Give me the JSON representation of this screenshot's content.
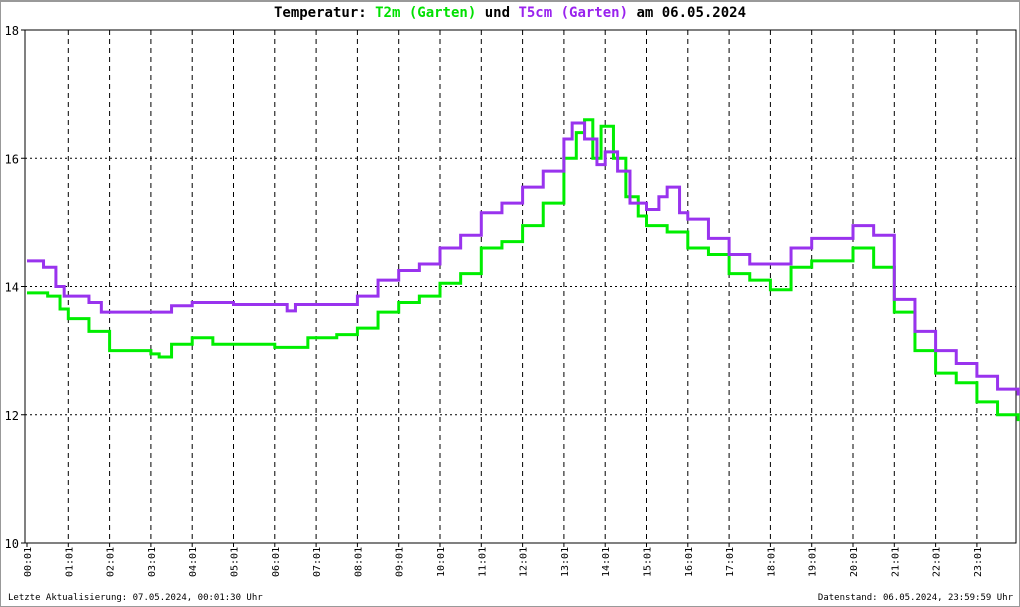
{
  "title": {
    "prefix": "Temperatur: ",
    "series1": "T2m (Garten)",
    "mid": " und ",
    "series2": "T5cm (Garten)",
    "suffix": " am 06.05.2024"
  },
  "footer": {
    "left": "Letzte Aktualisierung: 07.05.2024, 00:01:30 Uhr",
    "right": "Datenstand: 06.05.2024, 23:59:59 Uhr"
  },
  "chart_data": {
    "type": "line",
    "title": "Temperatur: T2m (Garten) und T5cm (Garten) am 06.05.2024",
    "xlabel": "",
    "ylabel": "",
    "ylim": [
      10,
      18
    ],
    "xlim_hours": [
      0,
      24
    ],
    "yticks": [
      "10",
      "12",
      "14",
      "16",
      "18"
    ],
    "xticks": [
      "00:01",
      "01:01",
      "02:01",
      "03:01",
      "04:01",
      "05:01",
      "06:01",
      "07:01",
      "08:01",
      "09:01",
      "10:01",
      "11:01",
      "12:01",
      "13:01",
      "14:01",
      "15:01",
      "16:01",
      "17:01",
      "18:01",
      "19:01",
      "20:01",
      "21:01",
      "22:01",
      "23:01"
    ],
    "grid": true,
    "series": [
      {
        "name": "T2m (Garten)",
        "color": "#00ee00",
        "x": [
          0,
          0.5,
          0.8,
          1.0,
          1.5,
          2.0,
          3.0,
          3.2,
          3.5,
          4.0,
          4.5,
          5.0,
          6.0,
          6.8,
          7.5,
          8.0,
          8.5,
          9.0,
          9.5,
          10.0,
          10.5,
          11.0,
          11.5,
          12.0,
          12.5,
          13.0,
          13.3,
          13.5,
          13.7,
          13.9,
          14.2,
          14.5,
          14.8,
          15.0,
          15.5,
          16.0,
          16.5,
          17.0,
          17.5,
          18.0,
          18.5,
          19.0,
          19.5,
          20.0,
          20.5,
          21.0,
          21.5,
          22.0,
          22.5,
          23.0,
          23.5,
          24.0
        ],
        "y": [
          13.9,
          13.85,
          13.65,
          13.5,
          13.3,
          13.0,
          12.95,
          12.9,
          13.1,
          13.2,
          13.1,
          13.1,
          13.05,
          13.2,
          13.25,
          13.35,
          13.6,
          13.75,
          13.85,
          14.05,
          14.2,
          14.6,
          14.7,
          14.95,
          15.3,
          16.0,
          16.4,
          16.6,
          16.0,
          16.5,
          16.0,
          15.4,
          15.1,
          14.95,
          14.85,
          14.6,
          14.5,
          14.2,
          14.1,
          13.95,
          14.3,
          14.4,
          14.4,
          14.6,
          14.3,
          13.6,
          13.0,
          12.65,
          12.5,
          12.2,
          12.0,
          11.9
        ]
      },
      {
        "name": "T5cm (Garten)",
        "color": "#9933ee",
        "x": [
          0,
          0.4,
          0.7,
          0.9,
          1.5,
          1.8,
          2.5,
          3.5,
          4.0,
          5.0,
          6.0,
          6.3,
          6.5,
          7.5,
          8.0,
          8.5,
          9.0,
          9.5,
          10.0,
          10.5,
          11.0,
          11.5,
          12.0,
          12.5,
          13.0,
          13.2,
          13.5,
          13.8,
          14.0,
          14.3,
          14.6,
          15.0,
          15.3,
          15.5,
          15.8,
          16.0,
          16.5,
          17.0,
          17.5,
          18.0,
          18.5,
          19.0,
          19.5,
          20.0,
          20.5,
          21.0,
          21.5,
          22.0,
          22.5,
          23.0,
          23.5,
          24.0
        ],
        "y": [
          14.4,
          14.3,
          14.0,
          13.85,
          13.75,
          13.6,
          13.6,
          13.7,
          13.75,
          13.72,
          13.72,
          13.62,
          13.72,
          13.72,
          13.85,
          14.1,
          14.25,
          14.35,
          14.6,
          14.8,
          15.15,
          15.3,
          15.55,
          15.8,
          16.3,
          16.55,
          16.3,
          15.9,
          16.1,
          15.8,
          15.3,
          15.2,
          15.4,
          15.55,
          15.15,
          15.05,
          14.75,
          14.5,
          14.35,
          14.35,
          14.6,
          14.75,
          14.75,
          14.95,
          14.8,
          13.8,
          13.3,
          13.0,
          12.8,
          12.6,
          12.4,
          12.3
        ]
      }
    ]
  }
}
